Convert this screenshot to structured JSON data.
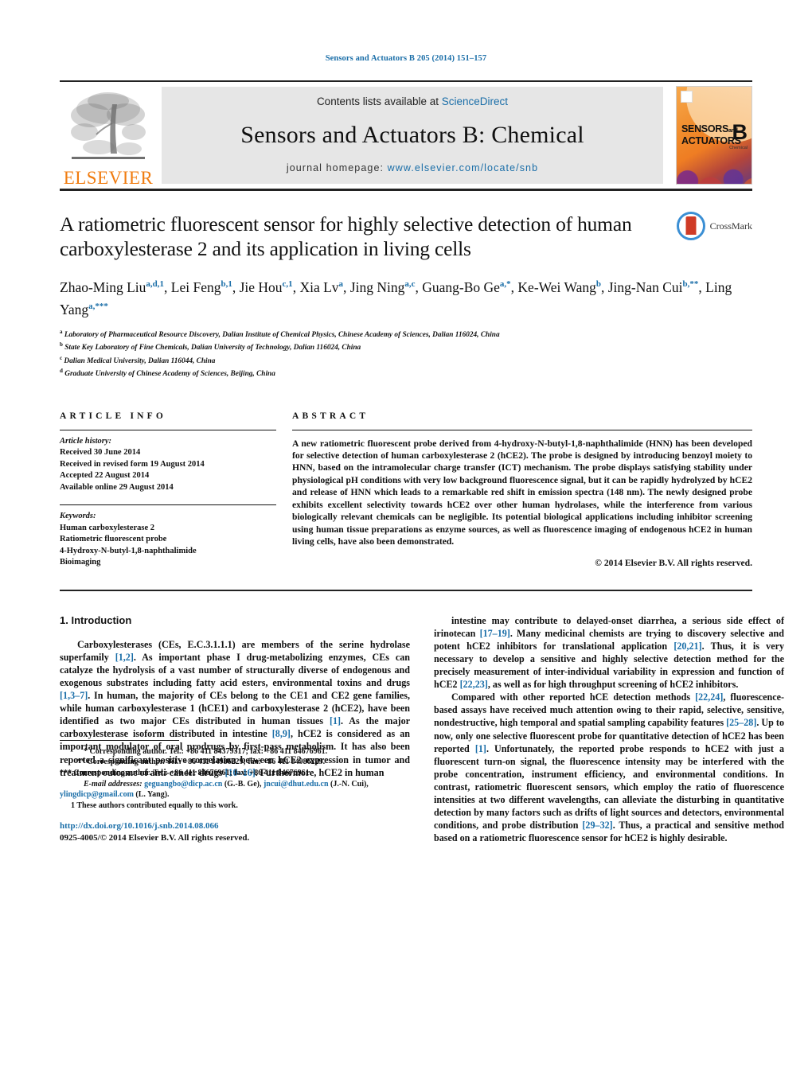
{
  "running_head": "Sensors and Actuators B 205 (2014) 151–157",
  "masthead": {
    "publisher_logo_text": "ELSEVIER",
    "contents_prefix": "Contents lists available at ",
    "sciencedirect": "ScienceDirect",
    "journal_title": "Sensors and Actuators B: Chemical",
    "homepage_label": "journal homepage:",
    "homepage_url": "www.elsevier.com/locate/snb",
    "cover": {
      "line1": "SENSORS",
      "line1_and": "and",
      "line2": "ACTUATORS",
      "letter": "B",
      "sub": "Chemical"
    }
  },
  "crossmark": {
    "label": "CrossMark"
  },
  "article": {
    "title": "A ratiometric fluorescent sensor for highly selective detection of human carboxylesterase 2 and its application in living cells",
    "authors": [
      {
        "name": "Zhao-Ming Liu",
        "sup": "a,d,1",
        "sep": ", "
      },
      {
        "name": "Lei Feng",
        "sup": "b,1",
        "sep": ", "
      },
      {
        "name": "Jie Hou",
        "sup": "c,1",
        "sep": ", "
      },
      {
        "name": "Xia Lv",
        "sup": "a",
        "sep": ", "
      },
      {
        "name": "Jing Ning",
        "sup": "a,c",
        "sep": ", "
      },
      {
        "name": "Guang-Bo Ge",
        "sup": "a,*",
        "sep": ", "
      },
      {
        "name": "Ke-Wei Wang",
        "sup": "b",
        "sep": ", "
      },
      {
        "name": "Jing-Nan Cui",
        "sup": "b,**",
        "sep": ", "
      },
      {
        "name": "Ling Yang",
        "sup": "a,***",
        "sep": ""
      }
    ],
    "affiliations": [
      {
        "marker": "a",
        "text": "Laboratory of Pharmaceutical Resource Discovery, Dalian Institute of Chemical Physics, Chinese Academy of Sciences, Dalian 116024, China"
      },
      {
        "marker": "b",
        "text": "State Key Laboratory of Fine Chemicals, Dalian University of Technology, Dalian 116024, China"
      },
      {
        "marker": "c",
        "text": "Dalian Medical University, Dalian 116044, China"
      },
      {
        "marker": "d",
        "text": "Graduate University of Chinese Academy of Sciences, Beijing, China"
      }
    ]
  },
  "article_info": {
    "heading": "ARTICLE INFO",
    "history_label": "Article history:",
    "history": [
      "Received 30 June 2014",
      "Received in revised form 19 August 2014",
      "Accepted 22 August 2014",
      "Available online 29 August 2014"
    ],
    "keywords_label": "Keywords:",
    "keywords": [
      "Human carboxylesterase 2",
      "Ratiometric fluorescent probe",
      "4-Hydroxy-N-butyl-1,8-naphthalimide",
      "Bioimaging"
    ]
  },
  "abstract": {
    "heading": "ABSTRACT",
    "text": "A new ratiometric fluorescent probe derived from 4-hydroxy-N-butyl-1,8-naphthalimide (HNN) has been developed for selective detection of human carboxylesterase 2 (hCE2). The probe is designed by introducing benzoyl moiety to HNN, based on the intramolecular charge transfer (ICT) mechanism. The probe displays satisfying stability under physiological pH conditions with very low background fluorescence signal, but it can be rapidly hydrolyzed by hCE2 and release of HNN which leads to a remarkable red shift in emission spectra (148 nm). The newly designed probe exhibits excellent selectivity towards hCE2 over other human hydrolases, while the interference from various biologically relevant chemicals can be negligible. Its potential biological applications including inhibitor screening using human tissue preparations as enzyme sources, as well as fluorescence imaging of endogenous hCE2 in human living cells, have also been demonstrated.",
    "copyright": "© 2014 Elsevier B.V. All rights reserved."
  },
  "introduction": {
    "heading": "1. Introduction",
    "left_paragraphs": [
      "Carboxylesterases (CEs, E.C.3.1.1.1) are members of the serine hydrolase superfamily [1,2]. As important phase I drug-metabolizing enzymes, CEs can catalyze the hydrolysis of a vast number of structurally diverse of endogenous and exogenous substrates including fatty acid esters, environmental toxins and drugs [1,3–7]. In human, the majority of CEs belong to the CE1 and CE2 gene families, while human carboxylesterase 1 (hCE1) and carboxylesterase 2 (hCE2), have been identified as two major CEs distributed in human tissues [1]. As the major carboxylesterase isoform distributed in intestine [8,9], hCE2 is considered as an important modulator of oral prodrugs by first-pass metabolism. It has also been reported a significant positive correlation between hCE2 expression in tumor and treatment outcome of anti-cancer drugs [10–16]. Furthermore, hCE2 in human"
    ],
    "right_paragraphs": [
      "intestine may contribute to delayed-onset diarrhea, a serious side effect of irinotecan [17–19]. Many medicinal chemists are trying to discovery selective and potent hCE2 inhibitors for translational application [20,21]. Thus, it is very necessary to develop a sensitive and highly selective detection method for the precisely measurement of inter-individual variability in expression and function of hCE2 [22,23], as well as for high throughput screening of hCE2 inhibitors.",
      "Compared with other reported hCE detection methods [22,24], fluorescence-based assays have received much attention owing to their rapid, selective, sensitive, nondestructive, high temporal and spatial sampling capability features [25–28]. Up to now, only one selective fluorescent probe for quantitative detection of hCE2 has been reported [1]. Unfortunately, the reported probe responds to hCE2 with just a fluorescent turn-on signal, the fluorescence intensity may be interfered with the probe concentration, instrument efficiency, and environmental conditions. In contrast, ratiometric fluorescent sensors, which employ the ratio of fluorescence intensities at two different wavelengths, can alleviate the disturbing in quantitative detection by many factors such as drifts of light sources and detectors, environmental conditions, and probe distribution [29–32]. Thus, a practical and sensitive method based on a ratiometric fluorescence sensor for hCE2 is highly desirable."
    ]
  },
  "footnotes": {
    "corr1": "* Corresponding author. Tel.: +86 411 84379317; fax: +86 411 84676961.",
    "corr2": "** Corresponding author. Tel.: +86 411 84986229; fax: +86 411 84986229.",
    "corr3": "*** Corresponding author. Tel.: +86 411 84676961; fax: +86 411 84676961.",
    "email_label": "E-mail addresses:",
    "email1": "geguangbo@dicp.ac.cn",
    "email1_owner": "(G.-B. Ge),",
    "email2": "jncui@dhut.edu.cn",
    "email2_owner": "(J.-N. Cui),",
    "email3": "ylingdicp@gmail.com",
    "email3_owner": "(L. Yang).",
    "equal_contrib": "1  These authors contributed equally to this work.",
    "doi": "http://dx.doi.org/10.1016/j.snb.2014.08.066",
    "issn": "0925-4005/© 2014 Elsevier B.V. All rights reserved."
  }
}
